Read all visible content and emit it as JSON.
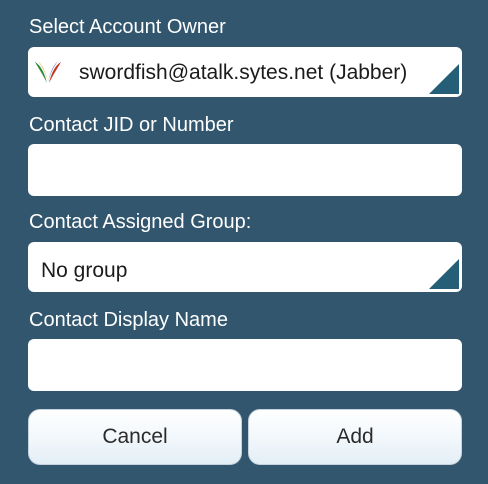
{
  "form": {
    "account_owner_label": "Select Account Owner",
    "account_owner_value": "swordfish@atalk.sytes.net (Jabber)",
    "account_icon": "jabber-protocol-icon",
    "contact_jid_label": "Contact JID or Number",
    "contact_jid_value": "",
    "group_label": "Contact Assigned Group:",
    "group_value": "No group",
    "display_name_label": "Contact Display Name",
    "display_name_value": ""
  },
  "actions": {
    "cancel_label": "Cancel",
    "add_label": "Add"
  },
  "colors": {
    "background": "#31566e",
    "spinner_corner": "#245e77",
    "button_text": "#2b2b2b"
  }
}
